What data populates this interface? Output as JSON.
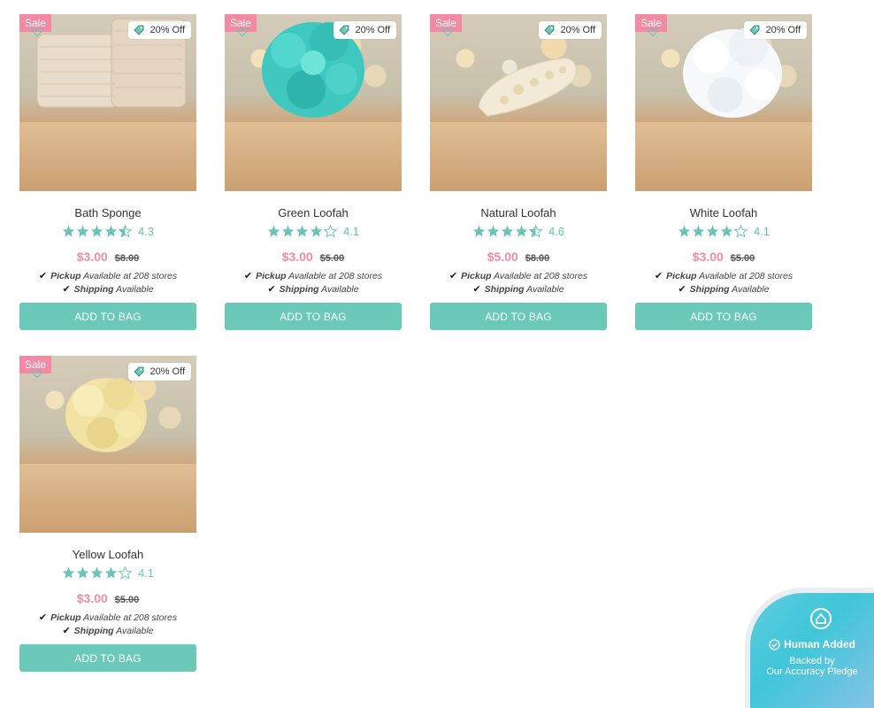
{
  "products": [
    {
      "name": "Bath Sponge",
      "rating": "4.3",
      "stars": 4.3,
      "price": "$3.00",
      "was": "$8.00",
      "sale": "Sale",
      "off": "20% Off",
      "pickup_label": "Pickup",
      "pickup_text": "Available at 208 stores",
      "shipping_label": "Shipping",
      "shipping_text": "Available",
      "button": "ADD TO BAG",
      "kind": "sponge"
    },
    {
      "name": "Green Loofah",
      "rating": "4.1",
      "stars": 4.1,
      "price": "$3.00",
      "was": "$5.00",
      "sale": "Sale",
      "off": "20% Off",
      "pickup_label": "Pickup",
      "pickup_text": "Available at 208 stores",
      "shipping_label": "Shipping",
      "shipping_text": "Available",
      "button": "ADD TO BAG",
      "kind": "green"
    },
    {
      "name": "Natural Loofah",
      "rating": "4.6",
      "stars": 4.6,
      "price": "$5.00",
      "was": "$8.00",
      "sale": "Sale",
      "off": "20% Off",
      "pickup_label": "Pickup",
      "pickup_text": "Available at 208 stores",
      "shipping_label": "Shipping",
      "shipping_text": "Available",
      "button": "ADD TO BAG",
      "kind": "natural"
    },
    {
      "name": "White Loofah",
      "rating": "4.1",
      "stars": 4.1,
      "price": "$3.00",
      "was": "$5.00",
      "sale": "Sale",
      "off": "20% Off",
      "pickup_label": "Pickup",
      "pickup_text": "Available at 208 stores",
      "shipping_label": "Shipping",
      "shipping_text": "Available",
      "button": "ADD TO BAG",
      "kind": "white"
    },
    {
      "name": "Yellow Loofah",
      "rating": "4.1",
      "stars": 4.1,
      "price": "$3.00",
      "was": "$5.00",
      "sale": "Sale",
      "off": "20% Off",
      "pickup_label": "Pickup",
      "pickup_text": "Available at 208 stores",
      "shipping_label": "Shipping",
      "shipping_text": "Available",
      "button": "ADD TO BAG",
      "kind": "yellow"
    }
  ],
  "pledge": {
    "title": "Human Added",
    "line1": "Backed by",
    "line2": "Our Accuracy Pledge"
  },
  "colors": {
    "accent": "#6ac9b8",
    "sale": "#f28aa3",
    "star": "#6bc4b8"
  }
}
